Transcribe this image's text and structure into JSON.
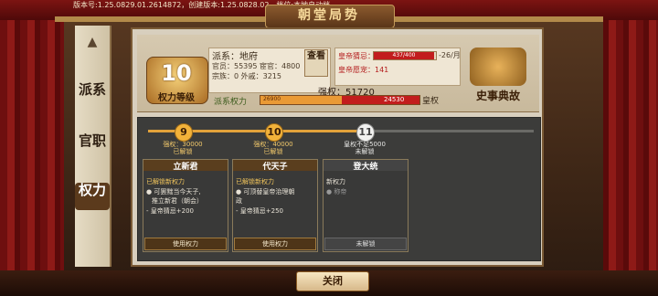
{
  "header": {
    "version": "版本号:1.25.0829.01.2614872，创建版本:1.25.0828.02，档位:本地自动档",
    "title": "朝堂局势"
  },
  "tabs": {
    "deco": "▲",
    "faction": "派系",
    "office": "官职",
    "power": "权力"
  },
  "rank": {
    "number": "10",
    "label": "权力等级"
  },
  "faction": {
    "name": "派系：地府",
    "officials": "官员：55395 宦官：4800",
    "relatives": "宗族：0       外戚：3215",
    "view_button": "查看"
  },
  "emperor": {
    "mood_label": "皇帝猜忌：",
    "mood_bar": "437/400",
    "mood_fraction": 1.0,
    "mood_rate": "-26/月",
    "affinity": "皇帝愿宠：141"
  },
  "power_bar": {
    "label": "派系权力",
    "clout_label": "强权：51720",
    "left": "26900",
    "right": "24530",
    "imperial_label": "皇权",
    "fraction": 0.52
  },
  "history": {
    "label": "史事典故"
  },
  "tiers": [
    {
      "num": "9",
      "req": "强权：30000",
      "status": "已解锁"
    },
    {
      "num": "10",
      "req": "强权：40000",
      "status": "已解锁"
    },
    {
      "num": "11",
      "req": "皇权不足5000",
      "status": "未解锁"
    }
  ],
  "cards": [
    {
      "title": "立新君",
      "unlock": "已解锁新权力",
      "line1": "● 可罢黜当今天子,",
      "line2": "推立新君（朝会）",
      "line3": "- 皇帝猜忌+200",
      "button": "使用权力"
    },
    {
      "title": "代天子",
      "unlock": "已解锁新权力",
      "line1": "● 可顶替皇帝治理朝",
      "line2": "政",
      "line3": "- 皇帝猜忌+250",
      "button": "使用权力"
    },
    {
      "title": "登大统",
      "unlock": "新权力",
      "line1": "● 称帝",
      "line2": "",
      "line3": "",
      "button": "未解锁"
    }
  ],
  "close_label": "关闭"
}
